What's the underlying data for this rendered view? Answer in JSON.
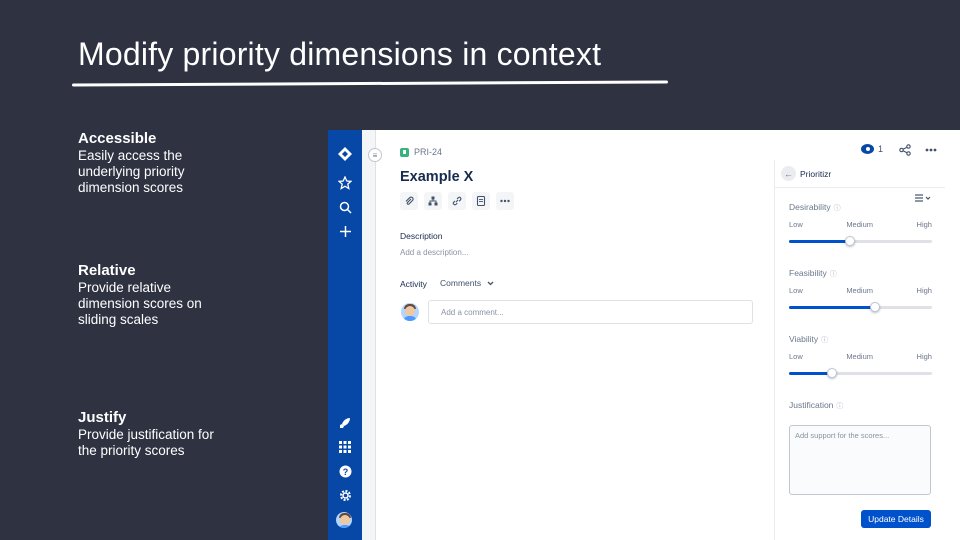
{
  "slide": {
    "title": "Modify priority dimensions in context"
  },
  "features": [
    {
      "title": "Accessible",
      "desc": "Easily access the underlying priority dimension scores"
    },
    {
      "title": "Relative",
      "desc": "Provide relative dimension scores on sliding scales"
    },
    {
      "title": "Justify",
      "desc": "Provide justification for the priority scores"
    }
  ],
  "issue": {
    "key": "PRI-24",
    "title": "Example X",
    "description_label": "Description",
    "description_placeholder": "Add a description...",
    "activity_label": "Activity",
    "activity_filter": "Comments",
    "comment_placeholder": "Add a comment...",
    "watchers": "1"
  },
  "panel": {
    "name": "Prioritizr",
    "dimensions": [
      {
        "name": "Desirability",
        "low": "Low",
        "medium": "Medium",
        "high": "High",
        "value": 0.43
      },
      {
        "name": "Feasibility",
        "low": "Low",
        "medium": "Medium",
        "high": "High",
        "value": 0.6
      },
      {
        "name": "Viability",
        "low": "Low",
        "medium": "Medium",
        "high": "High",
        "value": 0.3
      }
    ],
    "justification_label": "Justification",
    "justification_placeholder": "Add support for the scores...",
    "update_label": "Update Details"
  },
  "colors": {
    "background": "#2e3241",
    "nav": "#0747a6",
    "accent": "#0052cc"
  },
  "icons": {
    "nav_top": [
      "jira-logo-icon",
      "star-icon",
      "search-icon",
      "plus-icon"
    ],
    "nav_bottom": [
      "rocket-icon",
      "apps-grid-icon",
      "help-icon",
      "gear-icon",
      "user-avatar"
    ],
    "toolbar": [
      "attachment-icon",
      "child-issues-icon",
      "link-icon",
      "page-icon",
      "more-icon"
    ]
  }
}
